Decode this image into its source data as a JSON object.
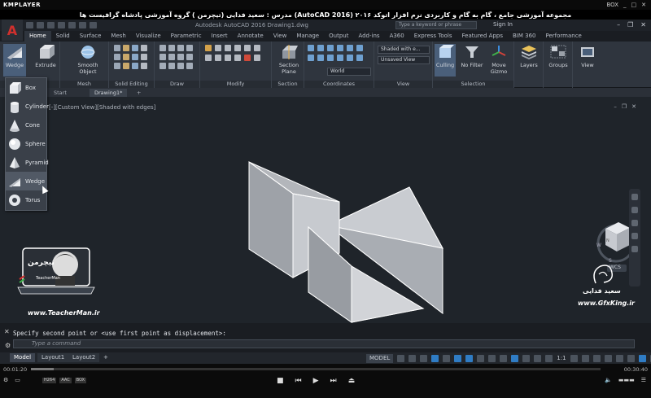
{
  "player": {
    "logo": "KMPLAYER",
    "right_label": "BOX",
    "time_elapsed": "00:01:20",
    "time_total": "00:30:40",
    "progress": 0.04,
    "badges": [
      "H264",
      "AAC",
      "BOX"
    ]
  },
  "banner": {
    "text": "مجموعه آموزشی جامع ، گام به گام و کاربردی نرم افزار اتوکد ۲۰۱۶ (AutoCAD 2016)   مدرس : سعید فدایی (تیچرمن ) گروه آموزشی پادشاه گرافیست ها"
  },
  "acad": {
    "app_letter": "A",
    "file_title": "Autodesk AutoCAD 2016    Drawing1.dwg",
    "search_placeholder": "Type a keyword or phrase",
    "signin": "Sign In",
    "tabs": [
      "Home",
      "Solid",
      "Surface",
      "Mesh",
      "Visualize",
      "Parametric",
      "Insert",
      "Annotate",
      "View",
      "Manage",
      "Output",
      "Add-ins",
      "A360",
      "Express Tools",
      "Featured Apps",
      "BIM 360",
      "Performance"
    ]
  },
  "ribbon": {
    "wedge": "Wedge",
    "extrude": "Extrude",
    "smooth_object": "Smooth Object",
    "section_plane": "Section Plane",
    "culling": "Culling",
    "no_filter": "No Filter",
    "move_gizmo": "Move Gizmo",
    "layers": "Layers",
    "groups": "Groups",
    "view": "View",
    "visual_style": "Shaded with e...",
    "saved_view": "Unsaved View",
    "ucs": "World",
    "groups_row": [
      "Modeling",
      "Mesh",
      "Solid Editing",
      "Draw",
      "Modify",
      "Section",
      "Coordinates",
      "View",
      "Selection"
    ]
  },
  "doc_tabs": {
    "start": "Start",
    "drawing": "Drawing1*",
    "plus": "+"
  },
  "viewport": {
    "label": "[-][Custom View][Shaded with edges]",
    "wcs": "WCS"
  },
  "solid_menu": {
    "items": [
      "Box",
      "Cylinder",
      "Cone",
      "Sphere",
      "Pyramid",
      "Wedge",
      "Torus"
    ]
  },
  "watermarks": {
    "teacherman_url": "www.TeacherMan.ir",
    "gfx_url": "www.GfxKing.ir",
    "fa_name": "سعید فدایی",
    "badge_text": "TeacherMan"
  },
  "cmd": {
    "history": "Specify second point or <use first point as displacement>:",
    "placeholder": "Type a command"
  },
  "layout_tabs": [
    "Model",
    "Layout1",
    "Layout2"
  ],
  "status": {
    "model": "MODEL",
    "scale": "1:1"
  }
}
